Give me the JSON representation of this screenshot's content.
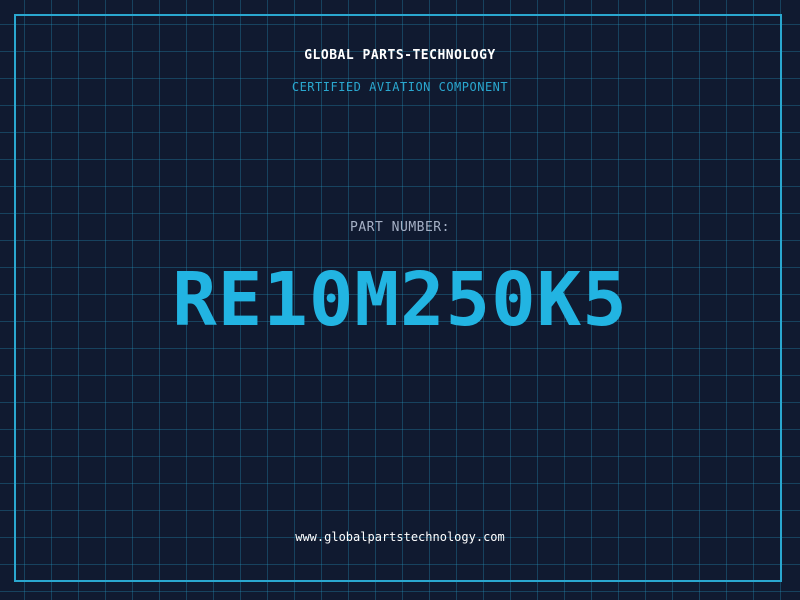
{
  "header": {
    "company_name": "GLOBAL PARTS-TECHNOLOGY",
    "subtitle": "CERTIFIED AVIATION COMPONENT"
  },
  "part": {
    "label": "PART NUMBER:",
    "number": "RE10M250K5"
  },
  "footer": {
    "website": "www.globalpartstechnology.com"
  },
  "colors": {
    "background": "#101a30",
    "accent": "#2aa7cf",
    "part_number": "#22b4e2",
    "label": "#a6b1c6",
    "text": "#ffffff"
  }
}
